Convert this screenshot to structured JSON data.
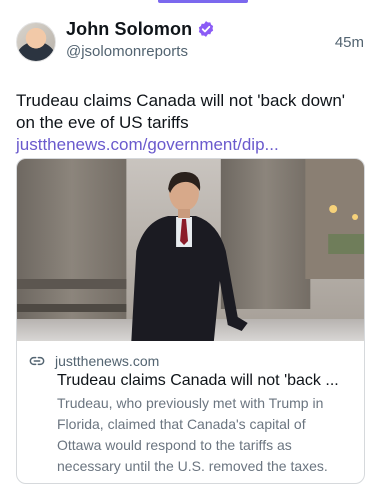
{
  "post": {
    "author": {
      "name": "John Solomon",
      "handle": "@jsolomonreports",
      "avatar_icon": "avatar-photo",
      "verified_color": "#8b5cf6"
    },
    "timestamp": "45m",
    "text_main": "Trudeau claims Canada will not 'back down' on the eve of US tariffs ",
    "text_link": "justthenews.com/government/dip...",
    "link_color": "#6a5acd"
  },
  "card": {
    "image_alt": "Man in dark coat walking outside stone building",
    "domain": "justthenews.com",
    "title": "Trudeau claims Canada will not 'back ...",
    "description": "Trudeau, who previously met with Trump in Florida, claimed that Canada's capital of Ottawa would respond to the tariffs as necessary until the U.S. removed the taxes."
  }
}
